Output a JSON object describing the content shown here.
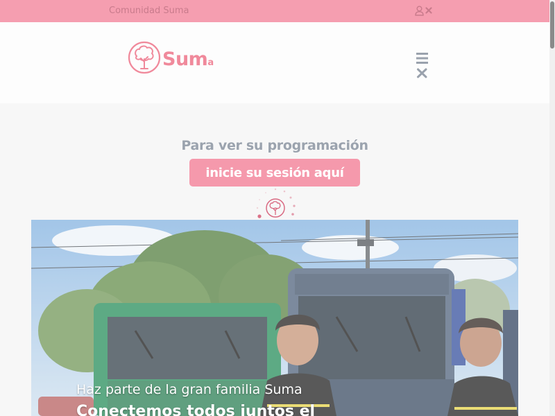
{
  "topbar": {
    "community_link": "Comunidad Suma",
    "icons": [
      "user-icon",
      "close-icon"
    ]
  },
  "header": {
    "logo_text": "Sum",
    "logo_text_end": "a",
    "menu_icons": [
      "hamburger-icon",
      "close-icon"
    ]
  },
  "main": {
    "prompt_text": "Para ver su programación",
    "login_button": "inicie su sesión aquí",
    "loader_icon": "tree-spinner-icon"
  },
  "hero": {
    "subtitle": "Haz parte de la gran familia Suma",
    "headline": "Conectemos todos juntos el"
  },
  "colors": {
    "brand_pink": "#f599ac",
    "topbar_pink": "#f59eb0",
    "logo_pink": "#f0899b",
    "muted_gray": "#9ba3ae"
  }
}
